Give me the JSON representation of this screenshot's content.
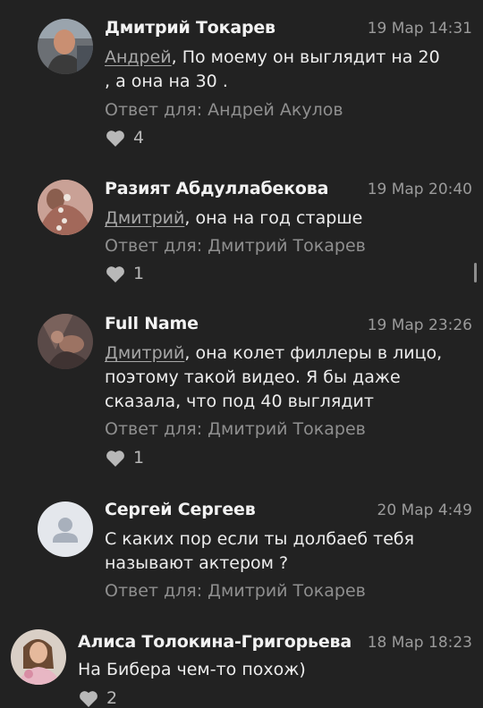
{
  "comments": [
    {
      "name": "Дмитрий Токарев",
      "time": "19 Мар 14:31",
      "mention": "Андрей",
      "text": ", По моему он выглядит на 20  , а она на 30 .",
      "reply": "Ответ для: Андрей Акулов",
      "likes": "4"
    },
    {
      "name": "Разият Абдуллабекова",
      "time": "19 Мар 20:40",
      "mention": "Дмитрий",
      "text": ", она на год старше",
      "reply": "Ответ для: Дмитрий Токарев",
      "likes": "1"
    },
    {
      "name": "Full Name",
      "time": "19 Мар 23:26",
      "mention": "Дмитрий",
      "text": ", она колет филлеры в лицо, поэтому такой видео. Я бы даже сказала, что под 40 выглядит",
      "reply": "Ответ для: Дмитрий Токарев",
      "likes": "1"
    },
    {
      "name": "Сергей Сергеев",
      "time": "20 Мар 4:49",
      "mention": "",
      "text": "С каких пор если ты долбаеб тебя называют актером ?",
      "reply": "Ответ для: Дмитрий Токарев",
      "likes": ""
    },
    {
      "name": "Алиса Толокина-Григорьева",
      "time": "18 Мар 18:23",
      "mention": "",
      "text": "На Бибера чем-то похож)",
      "reply": "",
      "likes": "2"
    }
  ]
}
